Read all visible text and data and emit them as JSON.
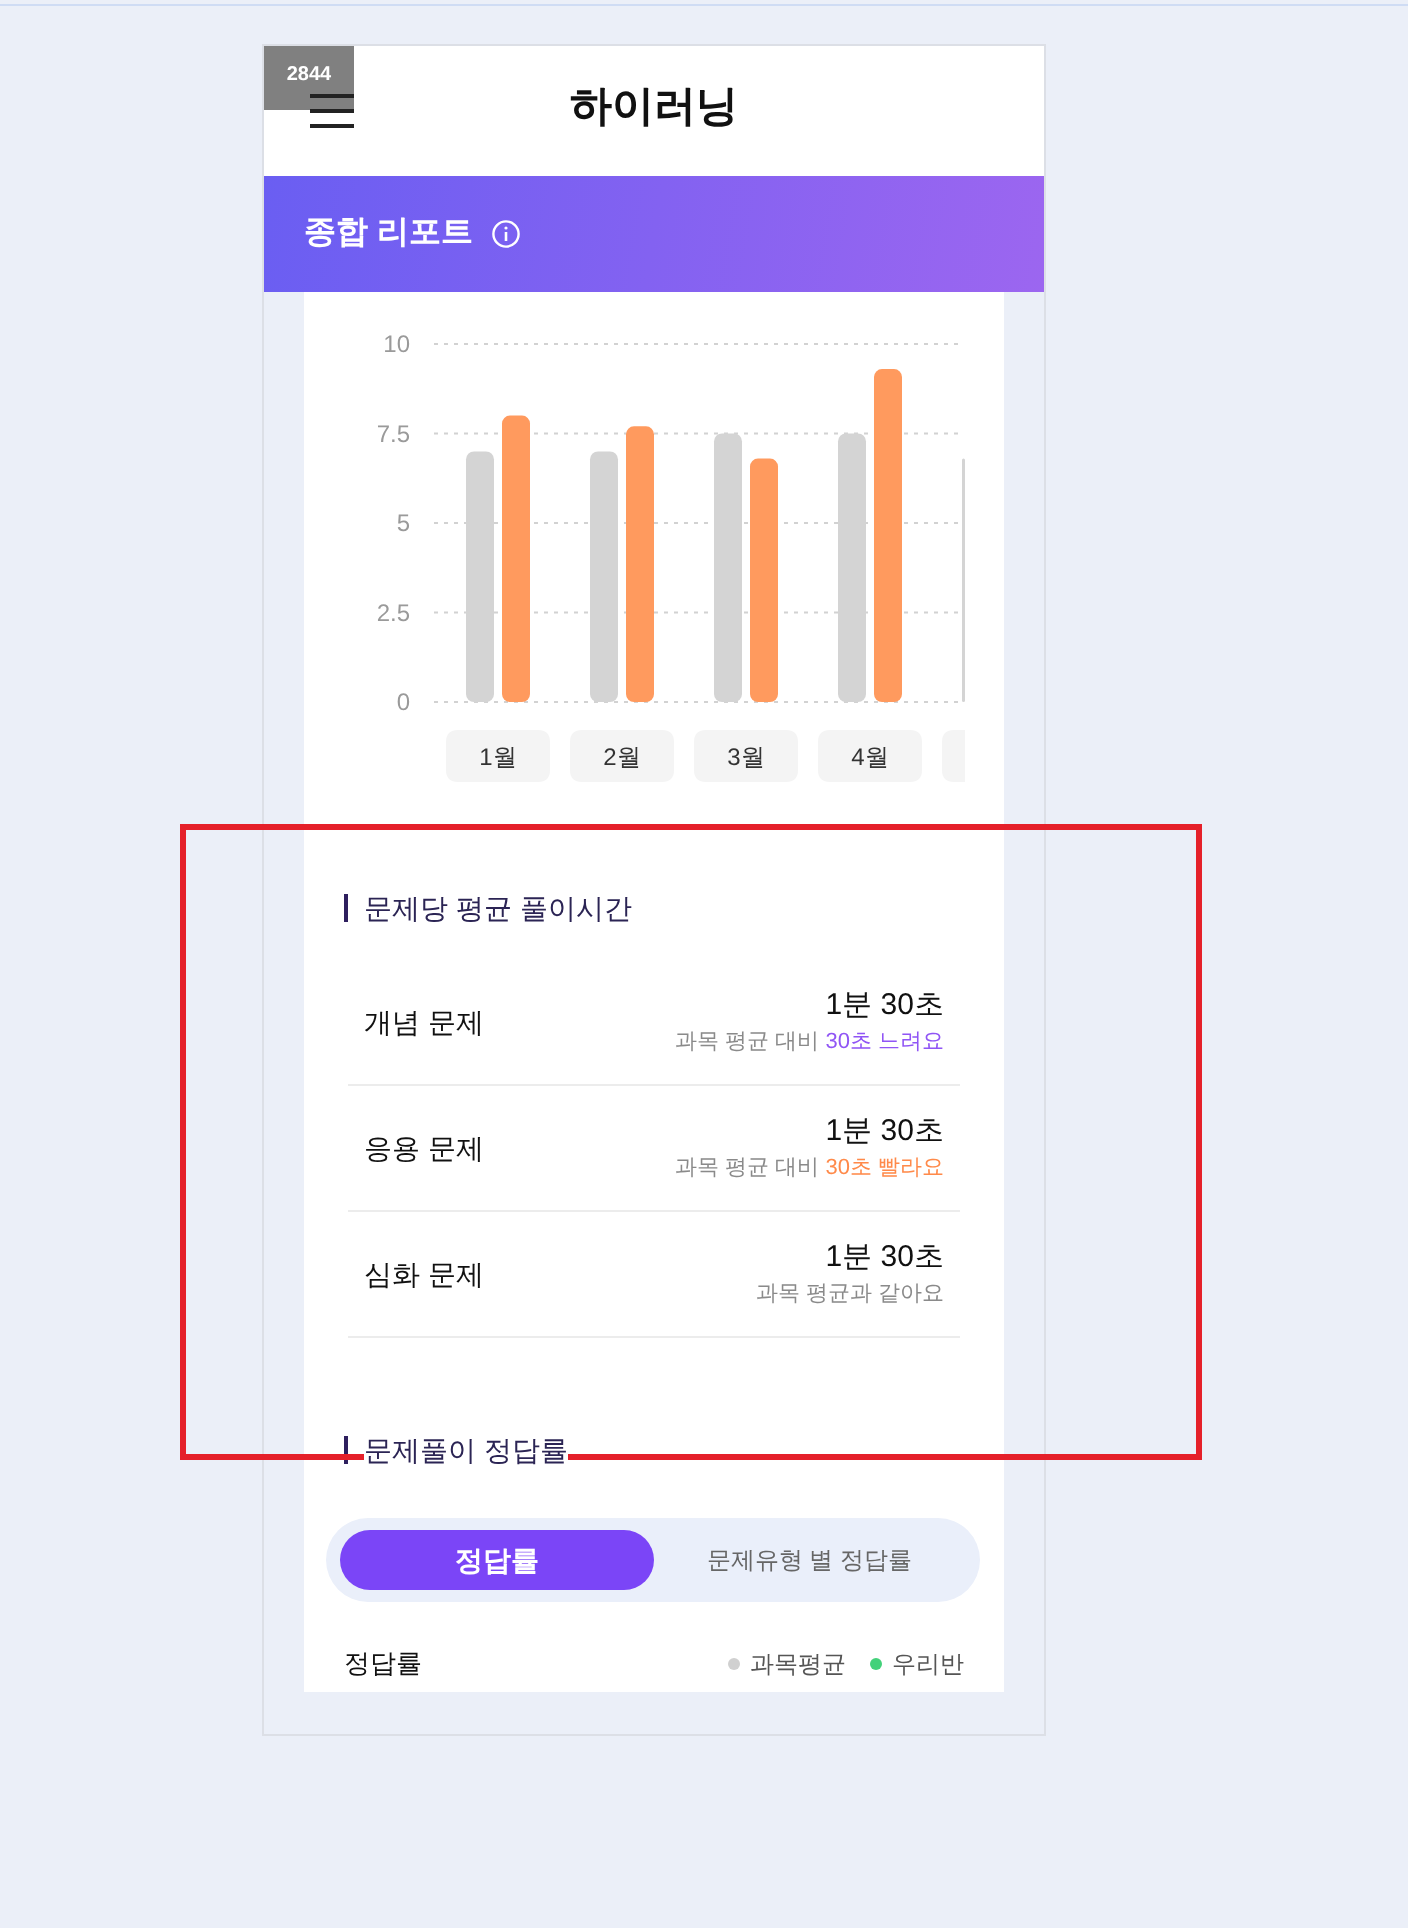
{
  "badge": "2844",
  "header": {
    "title": "하이러닝"
  },
  "banner": {
    "title": "종합 리포트"
  },
  "monthly_chart": {
    "chart_data": {
      "type": "bar",
      "categories": [
        "1월",
        "2월",
        "3월",
        "4월",
        null
      ],
      "series": [
        {
          "color": "#d4d4d4",
          "values": [
            7.0,
            7.0,
            7.5,
            7.5,
            6.8
          ]
        },
        {
          "color": "#ff9a5e",
          "values": [
            8.0,
            7.7,
            6.8,
            9.3,
            null
          ]
        }
      ],
      "ylim": [
        0,
        10
      ],
      "yticks": [
        0,
        2.5,
        5,
        7.5,
        10
      ],
      "grid": true
    }
  },
  "solve_time": {
    "title": "문제당 평균 풀이시간",
    "rows": [
      {
        "label": "개념 문제",
        "time": "1분 30초",
        "note": "과목 평균 대비",
        "diff": "30초 느려요",
        "kind": "slower"
      },
      {
        "label": "응용 문제",
        "time": "1분 30초",
        "note": "과목 평균 대비",
        "diff": "30초 빨라요",
        "kind": "faster"
      },
      {
        "label": "심화 문제",
        "time": "1분 30초",
        "note": "과목 평균과 같아요",
        "kind": "same"
      }
    ]
  },
  "accuracy": {
    "title": "문제풀이 정답률",
    "tabs": [
      {
        "label": "정답률",
        "selected": true
      },
      {
        "label": "문제유형 별 정답률",
        "selected": false
      }
    ],
    "chart_label": "정답률",
    "legend": [
      {
        "label": "과목평균",
        "color": "#d0d0d0"
      },
      {
        "label": "우리반",
        "color": "#43d17a"
      }
    ]
  },
  "highlight_frame": true
}
